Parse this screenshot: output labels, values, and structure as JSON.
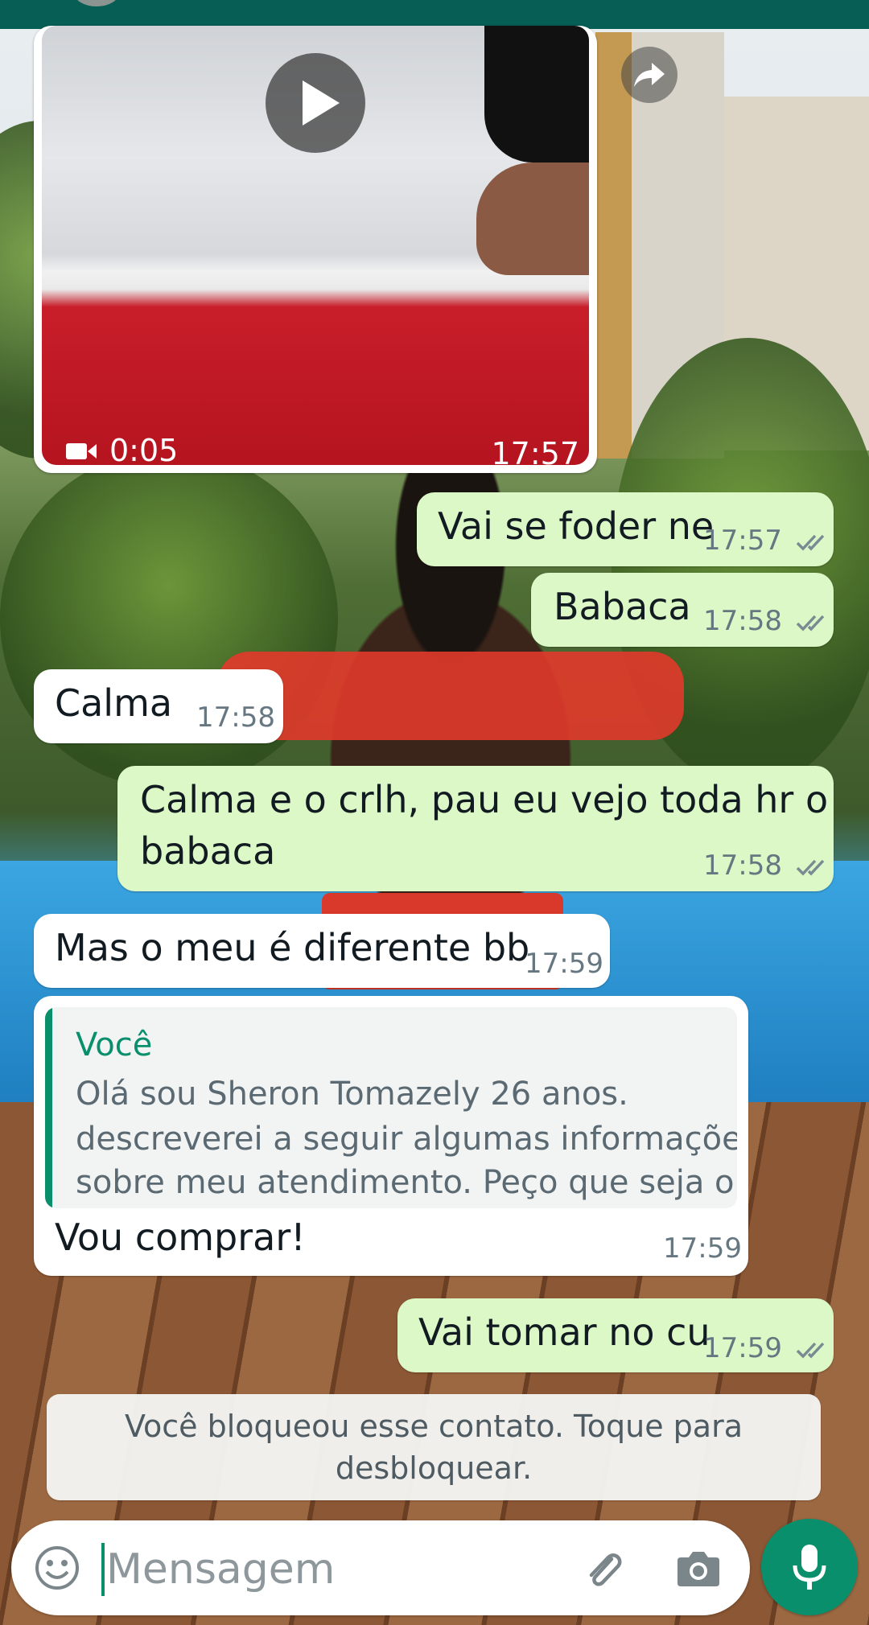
{
  "video_message": {
    "duration": "0:05",
    "time": "17:57"
  },
  "messages": [
    {
      "direction": "out",
      "text": "Vai se foder ne",
      "time": "17:57",
      "status": "read-ticks"
    },
    {
      "direction": "out",
      "text": "Babaca",
      "time": "17:58",
      "status": "read-ticks"
    },
    {
      "direction": "in",
      "text": "Calma",
      "time": "17:58"
    },
    {
      "direction": "out",
      "lines": [
        "Calma e o crlh, pau eu vejo toda hr o",
        "babaca"
      ],
      "time": "17:58",
      "status": "read-ticks"
    },
    {
      "direction": "in",
      "text": "Mas o meu é diferente  bb",
      "time": "17:59"
    },
    {
      "direction": "in",
      "quote": {
        "author": "Você",
        "lines": [
          "Olá sou Sheron Tomazely 26 anos.",
          "descreverei a seguir algumas informações",
          "sobre meu atendimento. Peço que seja o..."
        ]
      },
      "text": "Vou comprar!",
      "time": "17:59"
    },
    {
      "direction": "out",
      "text": "Vai tomar no cu",
      "time": "17:59",
      "status": "read-ticks"
    }
  ],
  "blocked_notice": {
    "line1": "Você bloqueou esse contato. Toque para",
    "line2": "desbloquear."
  },
  "composer": {
    "placeholder": "Mensagem",
    "icons": [
      "emoji-icon",
      "attach-icon",
      "camera-icon",
      "mic-icon"
    ]
  },
  "colors": {
    "header": "#075e54",
    "outgoing_bubble": "#dcf8c6",
    "incoming_bubble": "#ffffff",
    "accent": "#0a8f6d"
  }
}
